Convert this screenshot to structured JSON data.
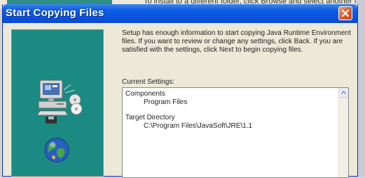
{
  "background_window": {
    "partial_text": "To install to a different folder, click Browse and select another folder."
  },
  "dialog": {
    "title": "Start Copying Files",
    "description": "Setup has enough information to start copying Java Runtime Environment files. If you want to review or change any settings, click Back. If you are satisfied with the settings, click Next to begin copying files.",
    "current_settings_label": "Current Settings:",
    "settings": {
      "components_heading": "Components",
      "components_value": "Program Files",
      "target_heading": "Target Directory",
      "target_value": "C:\\Program Files\\JavaSoft\\JRE\\1.1"
    }
  },
  "colors": {
    "titlebar": "#0a53dd",
    "banner": "#1b8a83",
    "close_button": "#e45a26"
  },
  "icons": [
    "computer-setup-icon",
    "globe-icon",
    "close-icon",
    "scroll-up-arrow-icon"
  ]
}
